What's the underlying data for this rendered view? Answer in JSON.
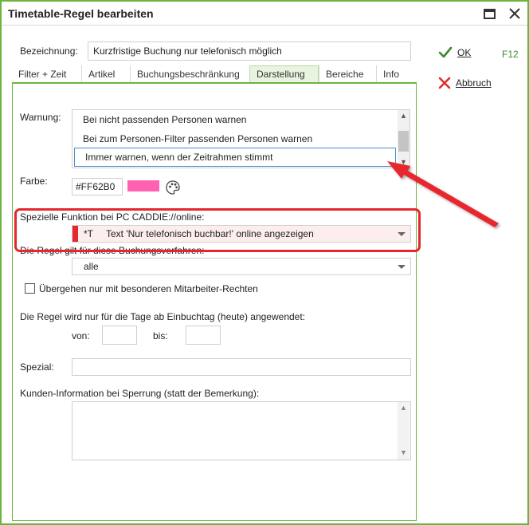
{
  "window": {
    "title": "Timetable-Regel bearbeiten"
  },
  "form": {
    "bezeichnung_label": "Bezeichnung:",
    "bezeichnung_value": "Kurzfristige Buchung nur telefonisch möglich"
  },
  "tabs": [
    {
      "label": "Filter + Zeit"
    },
    {
      "label": "Artikel"
    },
    {
      "label": "Buchungsbeschränkung"
    },
    {
      "label": "Darstellung"
    },
    {
      "label": "Bereiche"
    },
    {
      "label": "Info"
    }
  ],
  "active_tab": "Darstellung",
  "warnung": {
    "label": "Warnung:",
    "options": [
      "Bei nicht passenden Personen warnen",
      "Bei zum Personen-Filter passenden Personen warnen",
      "Immer warnen, wenn der Zeitrahmen stimmt"
    ],
    "selected_index": 2
  },
  "farbe": {
    "label": "Farbe:",
    "hex_value": "#FF62B0",
    "swatch_color": "#ff62b0"
  },
  "spezielle": {
    "label": "Spezielle Funktion bei PC CADDIE://online:",
    "code": "*T",
    "value": "Text 'Nur telefonisch buchbar!' online angezeigen",
    "marker_color": "#e8262d"
  },
  "buchungsverfahren": {
    "label": "Die Regel gilt für diese Buchungsverfahren:",
    "value": "alle"
  },
  "uebergehen": {
    "label": "Übergehen nur mit besonderen Mitarbeiter-Rechten",
    "checked": false
  },
  "tage": {
    "label": "Die Regel wird nur für die Tage ab Einbuchtag (heute) angewendet:",
    "von_label": "von:",
    "von_value": "",
    "bis_label": "bis:",
    "bis_value": ""
  },
  "spezial": {
    "label": "Spezial:",
    "value": ""
  },
  "kunden_info": {
    "label": "Kunden-Information bei Sperrung (statt der Bemerkung):",
    "value": ""
  },
  "actions": {
    "ok_label": "OK",
    "ok_shortcut": "F12",
    "cancel_label": "Abbruch"
  },
  "colors": {
    "accent_green": "#6db33f",
    "highlight_red": "#e8262d",
    "check_green": "#3d8a2a",
    "cancel_red": "#d93030"
  }
}
